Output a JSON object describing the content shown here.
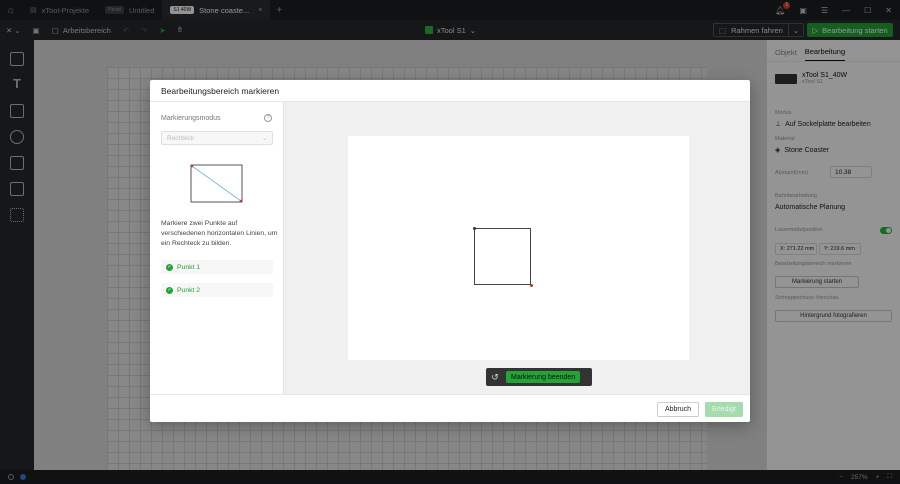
{
  "titlebar": {
    "tabs": [
      {
        "label": "xTool-Projekte"
      },
      {
        "badge": "Privat",
        "label": "Untitled"
      },
      {
        "badge": "S1 40W",
        "label": "Stone coaste...",
        "close": "×"
      }
    ],
    "add_tab": "+",
    "notification_count": "1"
  },
  "toolbar": {
    "workspace_label": "Arbeitsbereich",
    "device_name": "xTool S1",
    "frame_button": "Rahmen fahren",
    "start_button": "Bearbeitung starten"
  },
  "right_panel": {
    "tabs": [
      "Objekt",
      "Bearbeitung"
    ],
    "device": {
      "name": "xTool S1_40W",
      "sub": "xTool S1"
    },
    "mode_label": "Modus",
    "mode_value": "Auf Sockelplatte bearbeiten",
    "material_label": "Material",
    "material_value": "Stone Coaster",
    "distance_label": "Abstand(mm)",
    "distance_value": "10.38",
    "path_label": "Bahnbearbeitung",
    "path_value": "Automatische Planung",
    "laser_label": "Lasermodulposition",
    "laser_x": "X: 271.22 mm",
    "laser_y": "Y: 219.6 mm",
    "mark_area_label": "Bearbeitungsbereich markieren",
    "mark_start_button": "Markierung starten",
    "snapshot_label": "Schnappschuss-Vorschau",
    "photo_button": "Hintergrund fotografieren"
  },
  "statusbar": {
    "zoom": "257%"
  },
  "modal": {
    "title": "Bearbeitungsbereich markieren",
    "mode_label": "Markierungsmodus",
    "mode_value": "Rechteck",
    "instructions": "Markiere zwei Punkte auf verschiedenen horizontalen Linien, um ein Rechteck zu bilden.",
    "points": [
      "Punkt 1",
      "Punkt 2"
    ],
    "end_button": "Markierung beenden",
    "cancel_button": "Abbruch",
    "done_button": "Erledigt"
  },
  "colors": {
    "accent": "#23a338",
    "point_red": "#d32f2f"
  }
}
